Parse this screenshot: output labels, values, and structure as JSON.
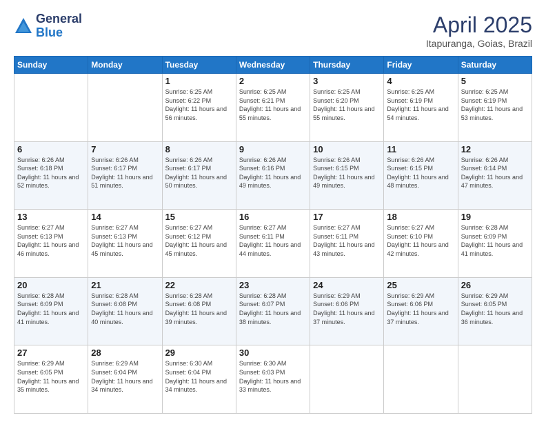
{
  "logo": {
    "general": "General",
    "blue": "Blue"
  },
  "title": "April 2025",
  "subtitle": "Itapuranga, Goias, Brazil",
  "days_of_week": [
    "Sunday",
    "Monday",
    "Tuesday",
    "Wednesday",
    "Thursday",
    "Friday",
    "Saturday"
  ],
  "weeks": [
    [
      {
        "day": "",
        "info": ""
      },
      {
        "day": "",
        "info": ""
      },
      {
        "day": "1",
        "sunrise": "6:25 AM",
        "sunset": "6:22 PM",
        "daylight": "11 hours and 56 minutes."
      },
      {
        "day": "2",
        "sunrise": "6:25 AM",
        "sunset": "6:21 PM",
        "daylight": "11 hours and 55 minutes."
      },
      {
        "day": "3",
        "sunrise": "6:25 AM",
        "sunset": "6:20 PM",
        "daylight": "11 hours and 55 minutes."
      },
      {
        "day": "4",
        "sunrise": "6:25 AM",
        "sunset": "6:19 PM",
        "daylight": "11 hours and 54 minutes."
      },
      {
        "day": "5",
        "sunrise": "6:25 AM",
        "sunset": "6:19 PM",
        "daylight": "11 hours and 53 minutes."
      }
    ],
    [
      {
        "day": "6",
        "sunrise": "6:26 AM",
        "sunset": "6:18 PM",
        "daylight": "11 hours and 52 minutes."
      },
      {
        "day": "7",
        "sunrise": "6:26 AM",
        "sunset": "6:17 PM",
        "daylight": "11 hours and 51 minutes."
      },
      {
        "day": "8",
        "sunrise": "6:26 AM",
        "sunset": "6:17 PM",
        "daylight": "11 hours and 50 minutes."
      },
      {
        "day": "9",
        "sunrise": "6:26 AM",
        "sunset": "6:16 PM",
        "daylight": "11 hours and 49 minutes."
      },
      {
        "day": "10",
        "sunrise": "6:26 AM",
        "sunset": "6:15 PM",
        "daylight": "11 hours and 49 minutes."
      },
      {
        "day": "11",
        "sunrise": "6:26 AM",
        "sunset": "6:15 PM",
        "daylight": "11 hours and 48 minutes."
      },
      {
        "day": "12",
        "sunrise": "6:26 AM",
        "sunset": "6:14 PM",
        "daylight": "11 hours and 47 minutes."
      }
    ],
    [
      {
        "day": "13",
        "sunrise": "6:27 AM",
        "sunset": "6:13 PM",
        "daylight": "11 hours and 46 minutes."
      },
      {
        "day": "14",
        "sunrise": "6:27 AM",
        "sunset": "6:13 PM",
        "daylight": "11 hours and 45 minutes."
      },
      {
        "day": "15",
        "sunrise": "6:27 AM",
        "sunset": "6:12 PM",
        "daylight": "11 hours and 45 minutes."
      },
      {
        "day": "16",
        "sunrise": "6:27 AM",
        "sunset": "6:11 PM",
        "daylight": "11 hours and 44 minutes."
      },
      {
        "day": "17",
        "sunrise": "6:27 AM",
        "sunset": "6:11 PM",
        "daylight": "11 hours and 43 minutes."
      },
      {
        "day": "18",
        "sunrise": "6:27 AM",
        "sunset": "6:10 PM",
        "daylight": "11 hours and 42 minutes."
      },
      {
        "day": "19",
        "sunrise": "6:28 AM",
        "sunset": "6:09 PM",
        "daylight": "11 hours and 41 minutes."
      }
    ],
    [
      {
        "day": "20",
        "sunrise": "6:28 AM",
        "sunset": "6:09 PM",
        "daylight": "11 hours and 41 minutes."
      },
      {
        "day": "21",
        "sunrise": "6:28 AM",
        "sunset": "6:08 PM",
        "daylight": "11 hours and 40 minutes."
      },
      {
        "day": "22",
        "sunrise": "6:28 AM",
        "sunset": "6:08 PM",
        "daylight": "11 hours and 39 minutes."
      },
      {
        "day": "23",
        "sunrise": "6:28 AM",
        "sunset": "6:07 PM",
        "daylight": "11 hours and 38 minutes."
      },
      {
        "day": "24",
        "sunrise": "6:29 AM",
        "sunset": "6:06 PM",
        "daylight": "11 hours and 37 minutes."
      },
      {
        "day": "25",
        "sunrise": "6:29 AM",
        "sunset": "6:06 PM",
        "daylight": "11 hours and 37 minutes."
      },
      {
        "day": "26",
        "sunrise": "6:29 AM",
        "sunset": "6:05 PM",
        "daylight": "11 hours and 36 minutes."
      }
    ],
    [
      {
        "day": "27",
        "sunrise": "6:29 AM",
        "sunset": "6:05 PM",
        "daylight": "11 hours and 35 minutes."
      },
      {
        "day": "28",
        "sunrise": "6:29 AM",
        "sunset": "6:04 PM",
        "daylight": "11 hours and 34 minutes."
      },
      {
        "day": "29",
        "sunrise": "6:30 AM",
        "sunset": "6:04 PM",
        "daylight": "11 hours and 34 minutes."
      },
      {
        "day": "30",
        "sunrise": "6:30 AM",
        "sunset": "6:03 PM",
        "daylight": "11 hours and 33 minutes."
      },
      {
        "day": "",
        "info": ""
      },
      {
        "day": "",
        "info": ""
      },
      {
        "day": "",
        "info": ""
      }
    ]
  ]
}
